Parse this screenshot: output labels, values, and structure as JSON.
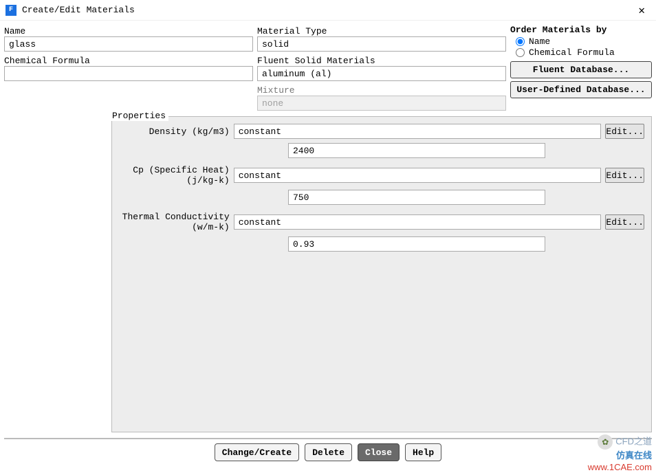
{
  "window": {
    "title": "Create/Edit Materials"
  },
  "left": {
    "name_label": "Name",
    "name_value": "glass",
    "formula_label": "Chemical Formula",
    "formula_value": ""
  },
  "mid": {
    "type_label": "Material Type",
    "type_value": "solid",
    "solids_label": "Fluent Solid Materials",
    "solids_value": "aluminum (al)",
    "mixture_label": "Mixture",
    "mixture_value": "none"
  },
  "right": {
    "order_label": "Order Materials by",
    "radio_name": "Name",
    "radio_formula": "Chemical Formula",
    "btn_fluent_db": "Fluent Database...",
    "btn_user_db": "User-Defined Database..."
  },
  "properties": {
    "legend": "Properties",
    "edit_label": "Edit...",
    "items": [
      {
        "label": "Density (kg/m3)",
        "method": "constant",
        "value": "2400"
      },
      {
        "label": "Cp (Specific Heat) (j/kg-k)",
        "method": "constant",
        "value": "750"
      },
      {
        "label": "Thermal Conductivity (w/m-k)",
        "method": "constant",
        "value": "0.93"
      }
    ]
  },
  "buttons": {
    "change_create": "Change/Create",
    "delete": "Delete",
    "close": "Close",
    "help": "Help"
  },
  "watermark": {
    "line1": "CFD之道",
    "line2": "仿真在线",
    "line3": "www.1CAE.com"
  }
}
